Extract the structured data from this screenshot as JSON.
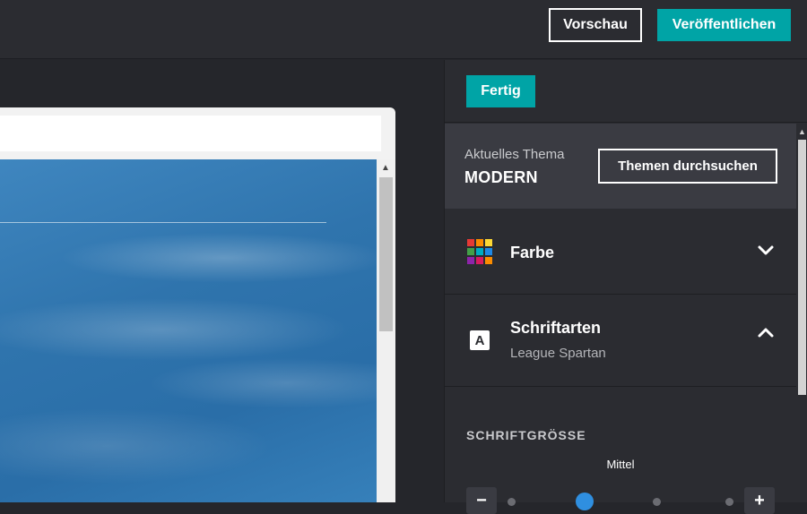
{
  "topbar": {
    "preview_label": "Vorschau",
    "publish_label": "Veröffentlichen"
  },
  "panel": {
    "done_label": "Fertig",
    "theme": {
      "label": "Aktuelles Thema",
      "name": "MODERN",
      "browse_label": "Themen durchsuchen"
    },
    "color_section": {
      "title": "Farbe",
      "swatches": [
        "#e53935",
        "#fb8c00",
        "#fdd835",
        "#43a047",
        "#00acc1",
        "#1e88e5",
        "#8e24aa",
        "#d81b60",
        "#fb8c00"
      ]
    },
    "fonts_section": {
      "title": "Schriftarten",
      "subtitle": "League Spartan",
      "icon_letter": "A"
    },
    "font_size": {
      "label": "SCHRIFTGRÖSSE",
      "value": "Mittel",
      "minus": "−",
      "plus": "+"
    }
  },
  "colors": {
    "accent": "#00a4a6",
    "slider_knob": "#2f8fe0"
  }
}
